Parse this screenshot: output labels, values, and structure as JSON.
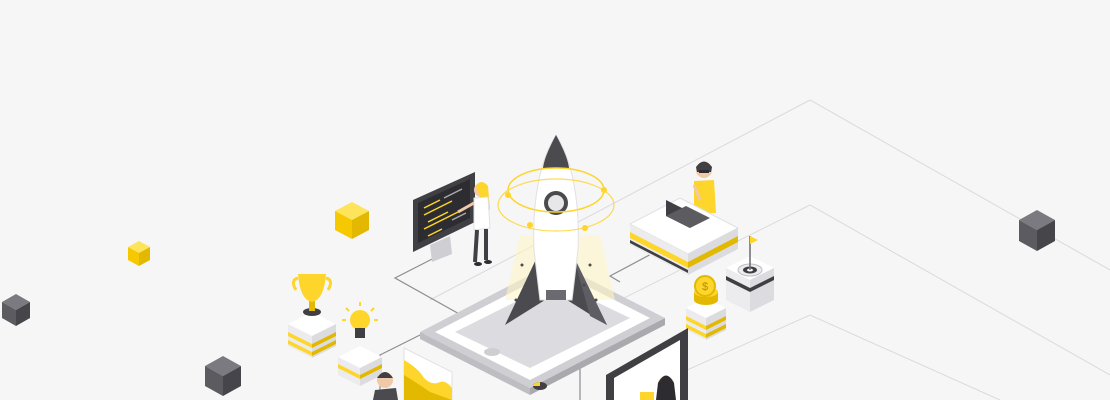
{
  "illustration": {
    "theme": "startup-launch-isometric",
    "palette": {
      "background": "#f6f6f6",
      "yellow": "#fdd52b",
      "yellow_dark": "#e2b800",
      "dark_gray": "#4a4a4f",
      "mid_gray": "#6a6a70",
      "light_gray": "#e7e7e9",
      "white": "#ffffff",
      "line": "#d4d4d6"
    },
    "elements": [
      "rocket-icon",
      "phone-platform",
      "code-monitor",
      "person-at-code-board",
      "person-at-laptop-desk",
      "trophy-icon",
      "lightbulb-icon",
      "coin-stack-icon",
      "target-flag-icon",
      "analytics-chart-panel",
      "person-at-tablet",
      "floating-cubes"
    ]
  }
}
